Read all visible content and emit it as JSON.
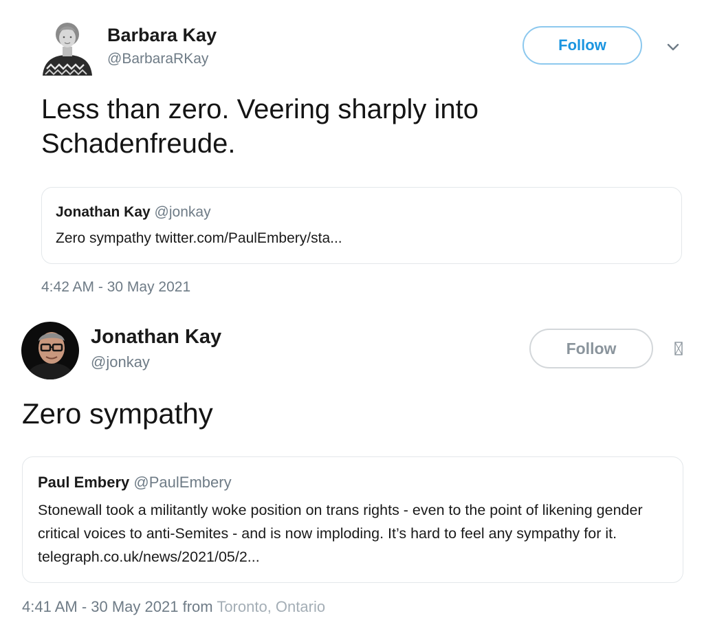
{
  "tweets": [
    {
      "author_name": "Barbara Kay",
      "author_handle": "@BarbaraRKay",
      "follow_label": "Follow",
      "text": "Less than zero. Veering sharply into Schadenfreude.",
      "quoted": {
        "author_name": "Jonathan Kay",
        "author_handle": "@jonkay",
        "text": "Zero sympathy twitter.com/PaulEmbery/sta..."
      },
      "timestamp": "4:42 AM - 30 May 2021",
      "menu_icon": "chevron-down-icon"
    },
    {
      "author_name": "Jonathan Kay",
      "author_handle": "@jonkay",
      "follow_label": "Follow",
      "text": "Zero sympathy",
      "quoted": {
        "author_name": "Paul Embery",
        "author_handle": "@PaulEmbery",
        "text": "Stonewall took a militantly woke position on trans rights - even to the point of likening gender critical voices to anti-Semites - and is now imploding. It’s hard to feel any sympathy for it. telegraph.co.uk/news/2021/05/2..."
      },
      "timestamp": "4:41 AM - 30 May 2021",
      "from_label": "from",
      "location": "Toronto, Ontario",
      "menu_icon": "more-icon"
    }
  ],
  "colors": {
    "accent": "#1b95e0",
    "follow_border_active": "#8cc8ee",
    "follow_border_muted": "#d3d7da",
    "secondary_text": "#6e7b86",
    "location_text": "#a4aeb6",
    "card_border": "#e3e7ea"
  }
}
